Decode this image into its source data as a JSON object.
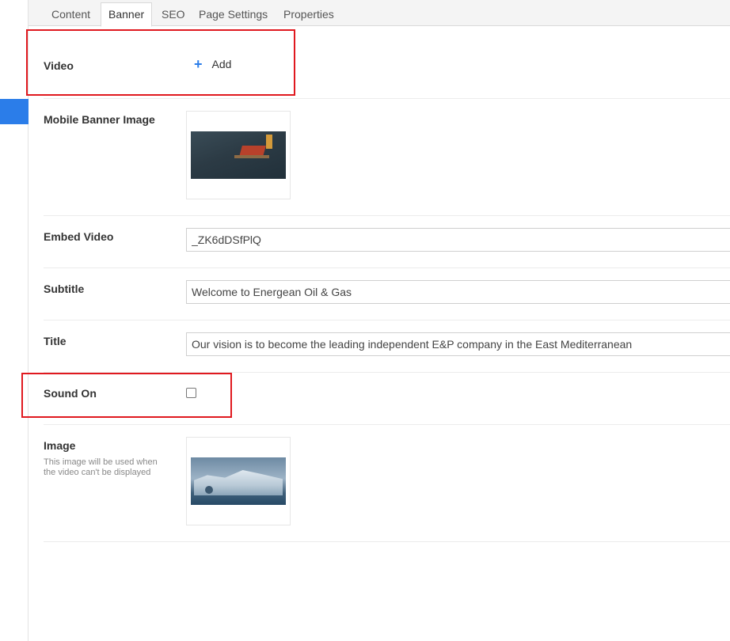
{
  "tabs": [
    {
      "label": "Content",
      "active": false
    },
    {
      "label": "Banner",
      "active": true
    },
    {
      "label": "SEO",
      "active": false
    },
    {
      "label": "Page Settings",
      "active": false
    },
    {
      "label": "Properties",
      "active": false
    }
  ],
  "form": {
    "video": {
      "label": "Video",
      "add_label": "Add"
    },
    "mobile_banner_image": {
      "label": "Mobile Banner Image"
    },
    "embed_video": {
      "label": "Embed Video",
      "value": "_ZK6dDSfPlQ"
    },
    "subtitle": {
      "label": "Subtitle",
      "value": "Welcome to Energean Oil & Gas"
    },
    "title": {
      "label": "Title",
      "value": "Our vision is to become the leading independent E&P company in the East Mediterranean"
    },
    "sound_on": {
      "label": "Sound On",
      "checked": false
    },
    "image": {
      "label": "Image",
      "help": "This image will be used when the video can't be displayed"
    }
  },
  "colors": {
    "accent": "#2b7de9",
    "highlight": "#e0191f"
  }
}
